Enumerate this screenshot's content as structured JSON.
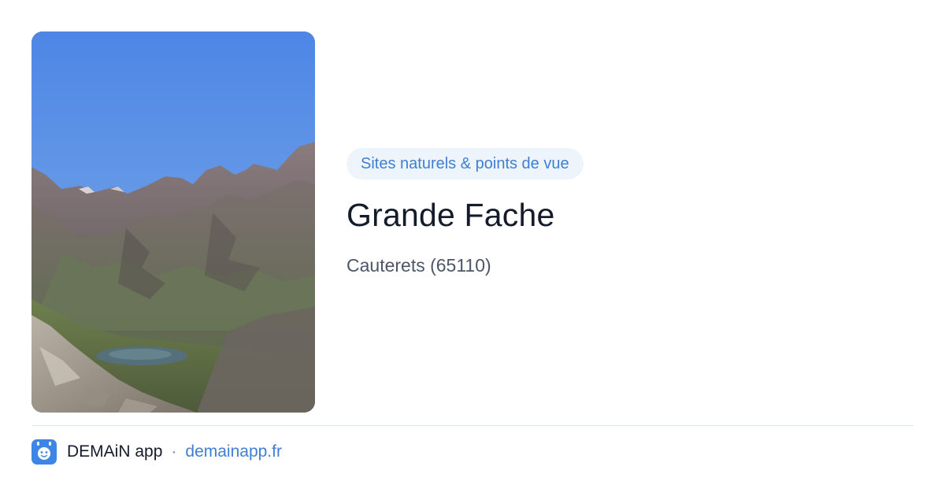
{
  "card": {
    "image_subject": "mountain landscape",
    "category": "Sites naturels & points de vue",
    "title": "Grande Fache",
    "location": "Cauterets (65110)"
  },
  "footer": {
    "brand": "DEMAiN app",
    "separator": "·",
    "website": "demainapp.fr",
    "logo_icon": "demain-app-logo-icon"
  },
  "colors": {
    "accent": "#3f7fd3",
    "chip_bg": "#eef4fc",
    "title": "#141b2b",
    "muted": "#4c5668",
    "divider": "#dbe4ea",
    "logo_bg": "#3d86e6"
  }
}
